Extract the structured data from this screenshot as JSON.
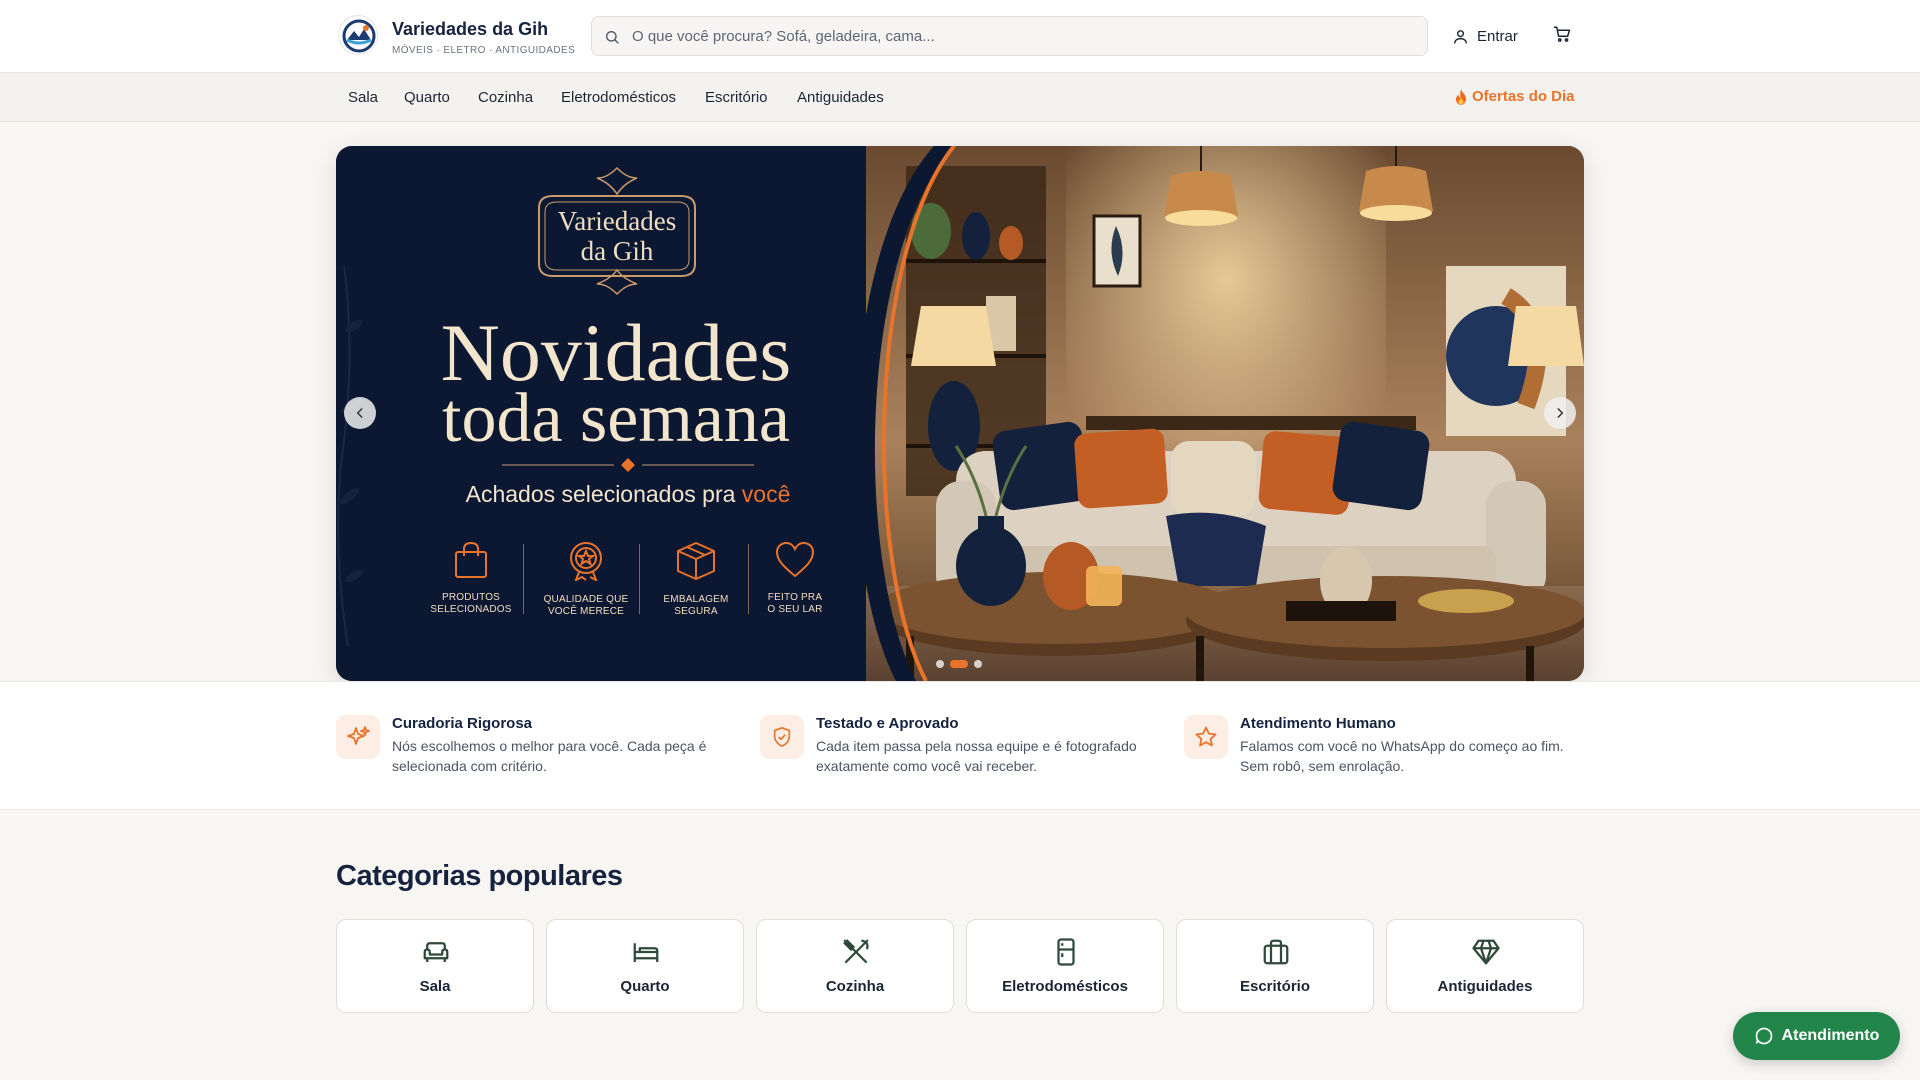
{
  "header": {
    "brand_name": "Variedades da Gih",
    "brand_tagline": "MÓVEIS · ELETRO · ANTIGUIDADES",
    "search_placeholder": "O que você procura? Sofá, geladeira, cama...",
    "search_value": "",
    "login_label": "Entrar",
    "icons": {
      "search": "search-icon",
      "user": "user-icon",
      "cart": "cart-icon"
    }
  },
  "nav": {
    "items": [
      {
        "label": "Sala"
      },
      {
        "label": "Quarto"
      },
      {
        "label": "Cozinha"
      },
      {
        "label": "Eletrodomésticos"
      },
      {
        "label": "Escritório"
      },
      {
        "label": "Antiguidades"
      }
    ],
    "deals_label": "Ofertas do Dia",
    "deals_icon": "fire-icon"
  },
  "hero": {
    "logo_line1": "Variedades",
    "logo_line2": "da Gih",
    "headline_line1": "Novidades",
    "headline_line2": "toda semana",
    "subtitle_prefix": "Achados selecionados pra",
    "subtitle_accent": "você",
    "features": [
      {
        "line1": "PRODUTOS",
        "line2": "SELECIONADOS",
        "icon": "shopping-bag-icon"
      },
      {
        "line1": "QUALIDADE QUE",
        "line2": "VOCÊ MERECE",
        "icon": "quality-badge-icon"
      },
      {
        "line1": "EMBALAGEM",
        "line2": "SEGURA",
        "icon": "package-icon"
      },
      {
        "line1": "FEITO PRA",
        "line2": "O SEU LAR",
        "icon": "heart-icon"
      }
    ],
    "slide_count": 3,
    "active_slide": 2,
    "colors": {
      "navy": "#0c1832",
      "cream": "#f3e4cc",
      "orange": "#e8742c"
    }
  },
  "benefits": [
    {
      "title": "Curadoria Rigorosa",
      "text": "Nós escolhemos o melhor para você. Cada peça é selecionada com critério.",
      "icon": "sparkles-icon"
    },
    {
      "title": "Testado e Aprovado",
      "text": "Cada item passa pela nossa equipe e é fotografado exatamente como você vai receber.",
      "icon": "shield-check-icon"
    },
    {
      "title": "Atendimento Humano",
      "text": "Falamos com você no WhatsApp do começo ao fim. Sem robô, sem enrolação.",
      "icon": "star-icon"
    }
  ],
  "categories": {
    "title": "Categorias populares",
    "items": [
      {
        "label": "Sala",
        "icon": "sofa-icon"
      },
      {
        "label": "Quarto",
        "icon": "bed-icon"
      },
      {
        "label": "Cozinha",
        "icon": "utensils-icon"
      },
      {
        "label": "Eletrodomésticos",
        "icon": "refrigerator-icon"
      },
      {
        "label": "Escritório",
        "icon": "briefcase-icon"
      },
      {
        "label": "Antiguidades",
        "icon": "gem-icon"
      }
    ]
  },
  "whatsapp": {
    "label": "Atendimento",
    "icon": "chat-icon",
    "color": "#22864a"
  }
}
